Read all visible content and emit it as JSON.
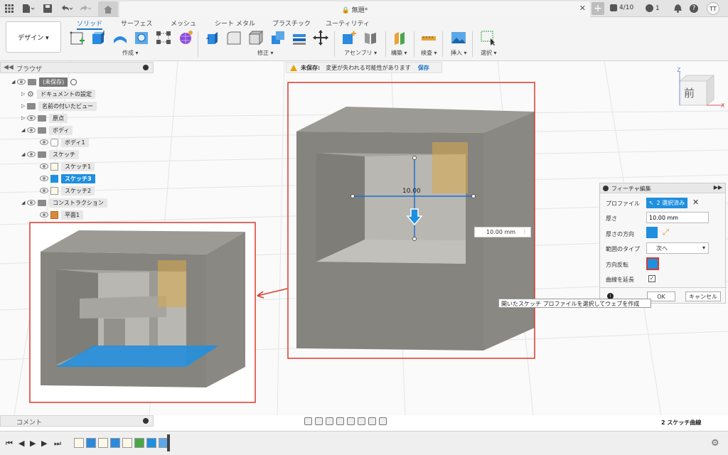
{
  "window": {
    "doc_title": "無題*",
    "job_count": "4/10",
    "notif_count": "1",
    "user_initials": "TT"
  },
  "toolbar": {
    "workspace": "デザイン ▾",
    "tabs": [
      "ソリッド",
      "サーフェス",
      "メッシュ",
      "シート メタル",
      "プラスチック",
      "ユーティリティ"
    ],
    "groups": [
      "作成 ▾",
      "修正 ▾",
      "アセンブリ ▾",
      "構築 ▾",
      "検査 ▾",
      "挿入 ▾",
      "選択 ▾"
    ]
  },
  "browser": {
    "title": "ブラウザ",
    "items": [
      {
        "label": "(未保存)"
      },
      {
        "label": "ドキュメントの設定"
      },
      {
        "label": "名前の付いたビュー"
      },
      {
        "label": "原点"
      },
      {
        "label": "ボディ"
      },
      {
        "label": "ボディ1"
      },
      {
        "label": "スケッチ"
      },
      {
        "label": "スケッチ1"
      },
      {
        "label": "スケッチ3"
      },
      {
        "label": "スケッチ2"
      },
      {
        "label": "コンストラクション"
      },
      {
        "label": "平面1"
      }
    ]
  },
  "warning": {
    "title": "未保存:",
    "message": "変更が失われる可能性があります",
    "save": "保存"
  },
  "viewcube": {
    "face": "前",
    "z": "Z",
    "x": "X"
  },
  "viewport": {
    "dim_label": "10.00",
    "dim_value": "10.00 mm"
  },
  "feature": {
    "title": "フィーチャ編集",
    "profile_label": "プロファイル",
    "profile_value": "2 選択済み",
    "thickness_label": "厚さ",
    "thickness_value": "10.00 mm",
    "direction_label": "厚さの方向",
    "range_label": "範囲のタイプ",
    "range_value": "次へ",
    "flip_label": "方向反転",
    "chain_label": "曲線を延長",
    "ok": "OK",
    "cancel": "キャンセル",
    "tooltip": "開いたスケッチ プロファイルを選択してウェブを作成"
  },
  "comments": {
    "title": "コメント"
  },
  "status": {
    "text": "2 スケッチ曲線"
  },
  "colors": {
    "accent": "#1f8fe0",
    "highlight": "#d93a2b"
  }
}
